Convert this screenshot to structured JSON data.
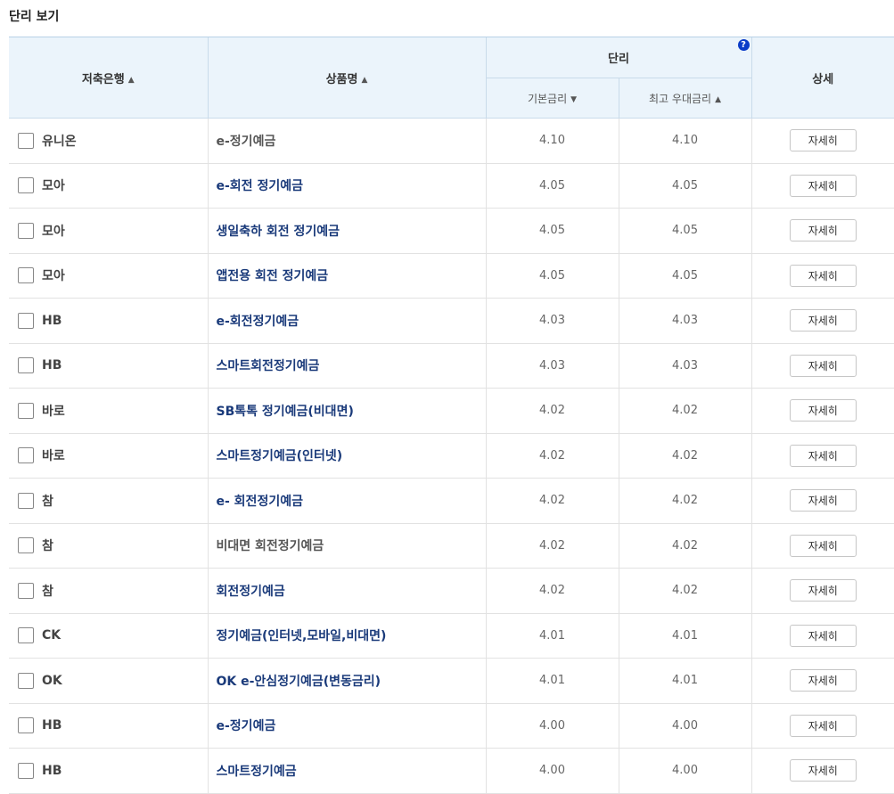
{
  "page": {
    "title": "단리 보기"
  },
  "header": {
    "bank": "저축은행",
    "product": "상품명",
    "simple_rate": "단리",
    "base_rate": "기본금리",
    "max_rate": "최고 우대금리",
    "detail": "상세",
    "help": "?"
  },
  "sort_icons": {
    "bank": "▲",
    "product": "▲",
    "base_rate": "▼",
    "max_rate": "▲"
  },
  "detail_button_label": "자세히",
  "rows": [
    {
      "bank": "유니온",
      "product": "e-정기예금",
      "base_rate": "4.10",
      "max_rate": "4.10"
    },
    {
      "bank": "모아",
      "product": "e-회전 정기예금",
      "base_rate": "4.05",
      "max_rate": "4.05"
    },
    {
      "bank": "모아",
      "product": "생일축하 회전 정기예금",
      "base_rate": "4.05",
      "max_rate": "4.05"
    },
    {
      "bank": "모아",
      "product": "앱전용 회전 정기예금",
      "base_rate": "4.05",
      "max_rate": "4.05"
    },
    {
      "bank": "HB",
      "product": "e-회전정기예금",
      "base_rate": "4.03",
      "max_rate": "4.03"
    },
    {
      "bank": "HB",
      "product": "스마트회전정기예금",
      "base_rate": "4.03",
      "max_rate": "4.03"
    },
    {
      "bank": "바로",
      "product": "SB톡톡 정기예금(비대면)",
      "base_rate": "4.02",
      "max_rate": "4.02"
    },
    {
      "bank": "바로",
      "product": "스마트정기예금(인터넷)",
      "base_rate": "4.02",
      "max_rate": "4.02"
    },
    {
      "bank": "참",
      "product": "e- 회전정기예금",
      "base_rate": "4.02",
      "max_rate": "4.02"
    },
    {
      "bank": "참",
      "product": "비대면 회전정기예금",
      "base_rate": "4.02",
      "max_rate": "4.02"
    },
    {
      "bank": "참",
      "product": "회전정기예금",
      "base_rate": "4.02",
      "max_rate": "4.02"
    },
    {
      "bank": "CK",
      "product": "정기예금(인터넷,모바일,비대면)",
      "base_rate": "4.01",
      "max_rate": "4.01"
    },
    {
      "bank": "OK",
      "product": "OK e-안심정기예금(변동금리)",
      "base_rate": "4.01",
      "max_rate": "4.01"
    },
    {
      "bank": "HB",
      "product": "e-정기예금",
      "base_rate": "4.00",
      "max_rate": "4.00"
    },
    {
      "bank": "HB",
      "product": "스마트정기예금",
      "base_rate": "4.00",
      "max_rate": "4.00"
    }
  ]
}
